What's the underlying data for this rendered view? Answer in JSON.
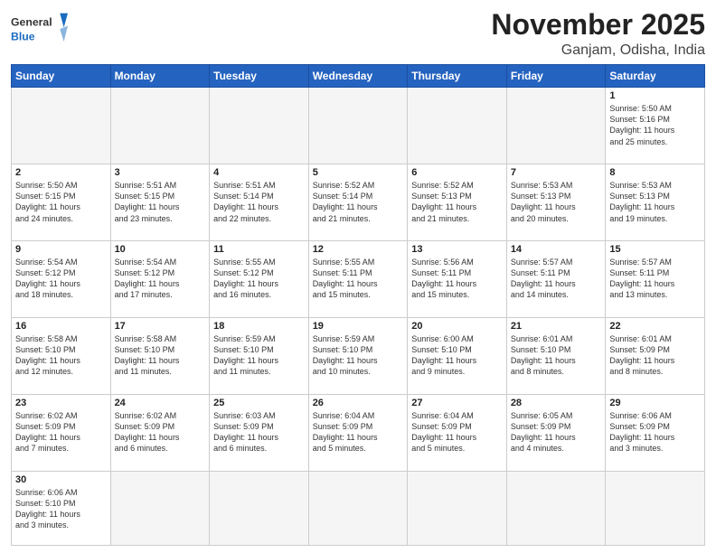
{
  "header": {
    "logo_general": "General",
    "logo_blue": "Blue",
    "title": "November 2025",
    "location": "Ganjam, Odisha, India"
  },
  "weekdays": [
    "Sunday",
    "Monday",
    "Tuesday",
    "Wednesday",
    "Thursday",
    "Friday",
    "Saturday"
  ],
  "weeks": [
    [
      {
        "day": "",
        "info": ""
      },
      {
        "day": "",
        "info": ""
      },
      {
        "day": "",
        "info": ""
      },
      {
        "day": "",
        "info": ""
      },
      {
        "day": "",
        "info": ""
      },
      {
        "day": "",
        "info": ""
      },
      {
        "day": "1",
        "info": "Sunrise: 5:50 AM\nSunset: 5:16 PM\nDaylight: 11 hours\nand 25 minutes."
      }
    ],
    [
      {
        "day": "2",
        "info": "Sunrise: 5:50 AM\nSunset: 5:15 PM\nDaylight: 11 hours\nand 24 minutes."
      },
      {
        "day": "3",
        "info": "Sunrise: 5:51 AM\nSunset: 5:15 PM\nDaylight: 11 hours\nand 23 minutes."
      },
      {
        "day": "4",
        "info": "Sunrise: 5:51 AM\nSunset: 5:14 PM\nDaylight: 11 hours\nand 22 minutes."
      },
      {
        "day": "5",
        "info": "Sunrise: 5:52 AM\nSunset: 5:14 PM\nDaylight: 11 hours\nand 21 minutes."
      },
      {
        "day": "6",
        "info": "Sunrise: 5:52 AM\nSunset: 5:13 PM\nDaylight: 11 hours\nand 21 minutes."
      },
      {
        "day": "7",
        "info": "Sunrise: 5:53 AM\nSunset: 5:13 PM\nDaylight: 11 hours\nand 20 minutes."
      },
      {
        "day": "8",
        "info": "Sunrise: 5:53 AM\nSunset: 5:13 PM\nDaylight: 11 hours\nand 19 minutes."
      }
    ],
    [
      {
        "day": "9",
        "info": "Sunrise: 5:54 AM\nSunset: 5:12 PM\nDaylight: 11 hours\nand 18 minutes."
      },
      {
        "day": "10",
        "info": "Sunrise: 5:54 AM\nSunset: 5:12 PM\nDaylight: 11 hours\nand 17 minutes."
      },
      {
        "day": "11",
        "info": "Sunrise: 5:55 AM\nSunset: 5:12 PM\nDaylight: 11 hours\nand 16 minutes."
      },
      {
        "day": "12",
        "info": "Sunrise: 5:55 AM\nSunset: 5:11 PM\nDaylight: 11 hours\nand 15 minutes."
      },
      {
        "day": "13",
        "info": "Sunrise: 5:56 AM\nSunset: 5:11 PM\nDaylight: 11 hours\nand 15 minutes."
      },
      {
        "day": "14",
        "info": "Sunrise: 5:57 AM\nSunset: 5:11 PM\nDaylight: 11 hours\nand 14 minutes."
      },
      {
        "day": "15",
        "info": "Sunrise: 5:57 AM\nSunset: 5:11 PM\nDaylight: 11 hours\nand 13 minutes."
      }
    ],
    [
      {
        "day": "16",
        "info": "Sunrise: 5:58 AM\nSunset: 5:10 PM\nDaylight: 11 hours\nand 12 minutes."
      },
      {
        "day": "17",
        "info": "Sunrise: 5:58 AM\nSunset: 5:10 PM\nDaylight: 11 hours\nand 11 minutes."
      },
      {
        "day": "18",
        "info": "Sunrise: 5:59 AM\nSunset: 5:10 PM\nDaylight: 11 hours\nand 11 minutes."
      },
      {
        "day": "19",
        "info": "Sunrise: 5:59 AM\nSunset: 5:10 PM\nDaylight: 11 hours\nand 10 minutes."
      },
      {
        "day": "20",
        "info": "Sunrise: 6:00 AM\nSunset: 5:10 PM\nDaylight: 11 hours\nand 9 minutes."
      },
      {
        "day": "21",
        "info": "Sunrise: 6:01 AM\nSunset: 5:10 PM\nDaylight: 11 hours\nand 8 minutes."
      },
      {
        "day": "22",
        "info": "Sunrise: 6:01 AM\nSunset: 5:09 PM\nDaylight: 11 hours\nand 8 minutes."
      }
    ],
    [
      {
        "day": "23",
        "info": "Sunrise: 6:02 AM\nSunset: 5:09 PM\nDaylight: 11 hours\nand 7 minutes."
      },
      {
        "day": "24",
        "info": "Sunrise: 6:02 AM\nSunset: 5:09 PM\nDaylight: 11 hours\nand 6 minutes."
      },
      {
        "day": "25",
        "info": "Sunrise: 6:03 AM\nSunset: 5:09 PM\nDaylight: 11 hours\nand 6 minutes."
      },
      {
        "day": "26",
        "info": "Sunrise: 6:04 AM\nSunset: 5:09 PM\nDaylight: 11 hours\nand 5 minutes."
      },
      {
        "day": "27",
        "info": "Sunrise: 6:04 AM\nSunset: 5:09 PM\nDaylight: 11 hours\nand 5 minutes."
      },
      {
        "day": "28",
        "info": "Sunrise: 6:05 AM\nSunset: 5:09 PM\nDaylight: 11 hours\nand 4 minutes."
      },
      {
        "day": "29",
        "info": "Sunrise: 6:06 AM\nSunset: 5:09 PM\nDaylight: 11 hours\nand 3 minutes."
      }
    ],
    [
      {
        "day": "30",
        "info": "Sunrise: 6:06 AM\nSunset: 5:10 PM\nDaylight: 11 hours\nand 3 minutes."
      },
      {
        "day": "",
        "info": ""
      },
      {
        "day": "",
        "info": ""
      },
      {
        "day": "",
        "info": ""
      },
      {
        "day": "",
        "info": ""
      },
      {
        "day": "",
        "info": ""
      },
      {
        "day": "",
        "info": ""
      }
    ]
  ]
}
